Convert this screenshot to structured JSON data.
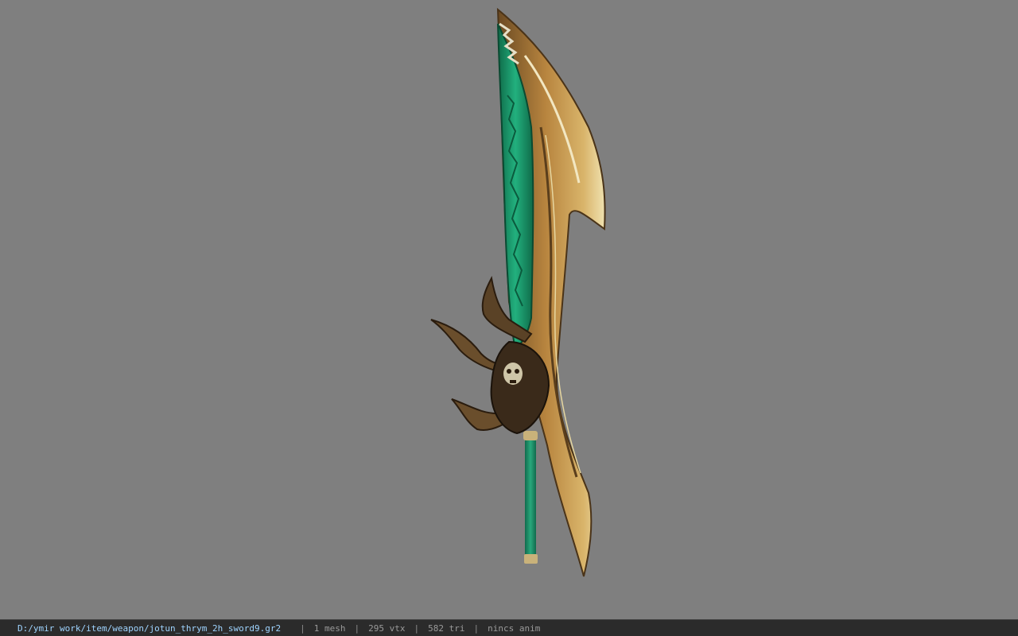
{
  "viewport": {
    "background": "#7f7f7f",
    "model_colors": {
      "blade_gold": "#b8853f",
      "blade_edge": "#e8d8a0",
      "inlay_green": "#1f9a6e",
      "handle_green": "#1f8f6a",
      "dark_metal": "#3a2a1a"
    }
  },
  "statusbar": {
    "file_path": "D:/ymir work/item/weapon/jotun_thrym_2h_sword9.gr2",
    "separator": "|",
    "mesh": "1 mesh",
    "vertices": "295 vtx",
    "triangles": "582 tri",
    "animation": "nincs anim"
  }
}
